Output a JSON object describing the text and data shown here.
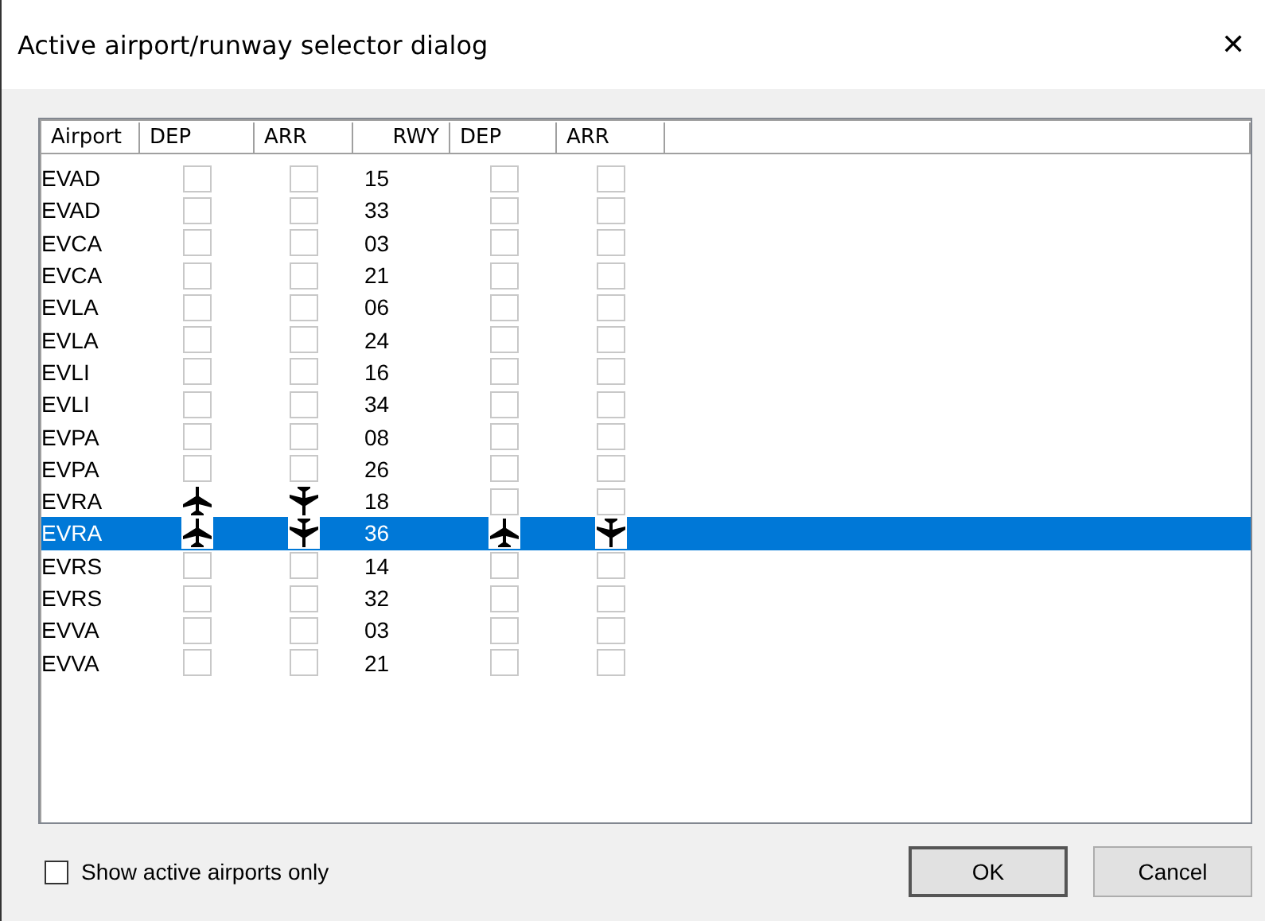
{
  "window": {
    "title": "Active airport/runway selector dialog",
    "close": "✕"
  },
  "table": {
    "columns": [
      "Airport",
      "DEP",
      "ARR",
      "RWY",
      "DEP",
      "ARR"
    ],
    "rows": [
      {
        "airport": "EVAD",
        "dep": false,
        "arr": false,
        "rwy": "15",
        "rwy_dep": false,
        "rwy_arr": false,
        "selected": false
      },
      {
        "airport": "EVAD",
        "dep": false,
        "arr": false,
        "rwy": "33",
        "rwy_dep": false,
        "rwy_arr": false,
        "selected": false
      },
      {
        "airport": "EVCA",
        "dep": false,
        "arr": false,
        "rwy": "03",
        "rwy_dep": false,
        "rwy_arr": false,
        "selected": false
      },
      {
        "airport": "EVCA",
        "dep": false,
        "arr": false,
        "rwy": "21",
        "rwy_dep": false,
        "rwy_arr": false,
        "selected": false
      },
      {
        "airport": "EVLA",
        "dep": false,
        "arr": false,
        "rwy": "06",
        "rwy_dep": false,
        "rwy_arr": false,
        "selected": false
      },
      {
        "airport": "EVLA",
        "dep": false,
        "arr": false,
        "rwy": "24",
        "rwy_dep": false,
        "rwy_arr": false,
        "selected": false
      },
      {
        "airport": "EVLI",
        "dep": false,
        "arr": false,
        "rwy": "16",
        "rwy_dep": false,
        "rwy_arr": false,
        "selected": false
      },
      {
        "airport": "EVLI",
        "dep": false,
        "arr": false,
        "rwy": "34",
        "rwy_dep": false,
        "rwy_arr": false,
        "selected": false
      },
      {
        "airport": "EVPA",
        "dep": false,
        "arr": false,
        "rwy": "08",
        "rwy_dep": false,
        "rwy_arr": false,
        "selected": false
      },
      {
        "airport": "EVPA",
        "dep": false,
        "arr": false,
        "rwy": "26",
        "rwy_dep": false,
        "rwy_arr": false,
        "selected": false
      },
      {
        "airport": "EVRA",
        "dep": true,
        "arr": true,
        "rwy": "18",
        "rwy_dep": false,
        "rwy_arr": false,
        "selected": false
      },
      {
        "airport": "EVRA",
        "dep": true,
        "arr": true,
        "rwy": "36",
        "rwy_dep": true,
        "rwy_arr": true,
        "selected": true
      },
      {
        "airport": "EVRS",
        "dep": false,
        "arr": false,
        "rwy": "14",
        "rwy_dep": false,
        "rwy_arr": false,
        "selected": false
      },
      {
        "airport": "EVRS",
        "dep": false,
        "arr": false,
        "rwy": "32",
        "rwy_dep": false,
        "rwy_arr": false,
        "selected": false
      },
      {
        "airport": "EVVA",
        "dep": false,
        "arr": false,
        "rwy": "03",
        "rwy_dep": false,
        "rwy_arr": false,
        "selected": false
      },
      {
        "airport": "EVVA",
        "dep": false,
        "arr": false,
        "rwy": "21",
        "rwy_dep": false,
        "rwy_arr": false,
        "selected": false
      }
    ]
  },
  "filter": {
    "label": "Show active airports only",
    "checked": false
  },
  "buttons": [
    "OK",
    "Cancel"
  ]
}
